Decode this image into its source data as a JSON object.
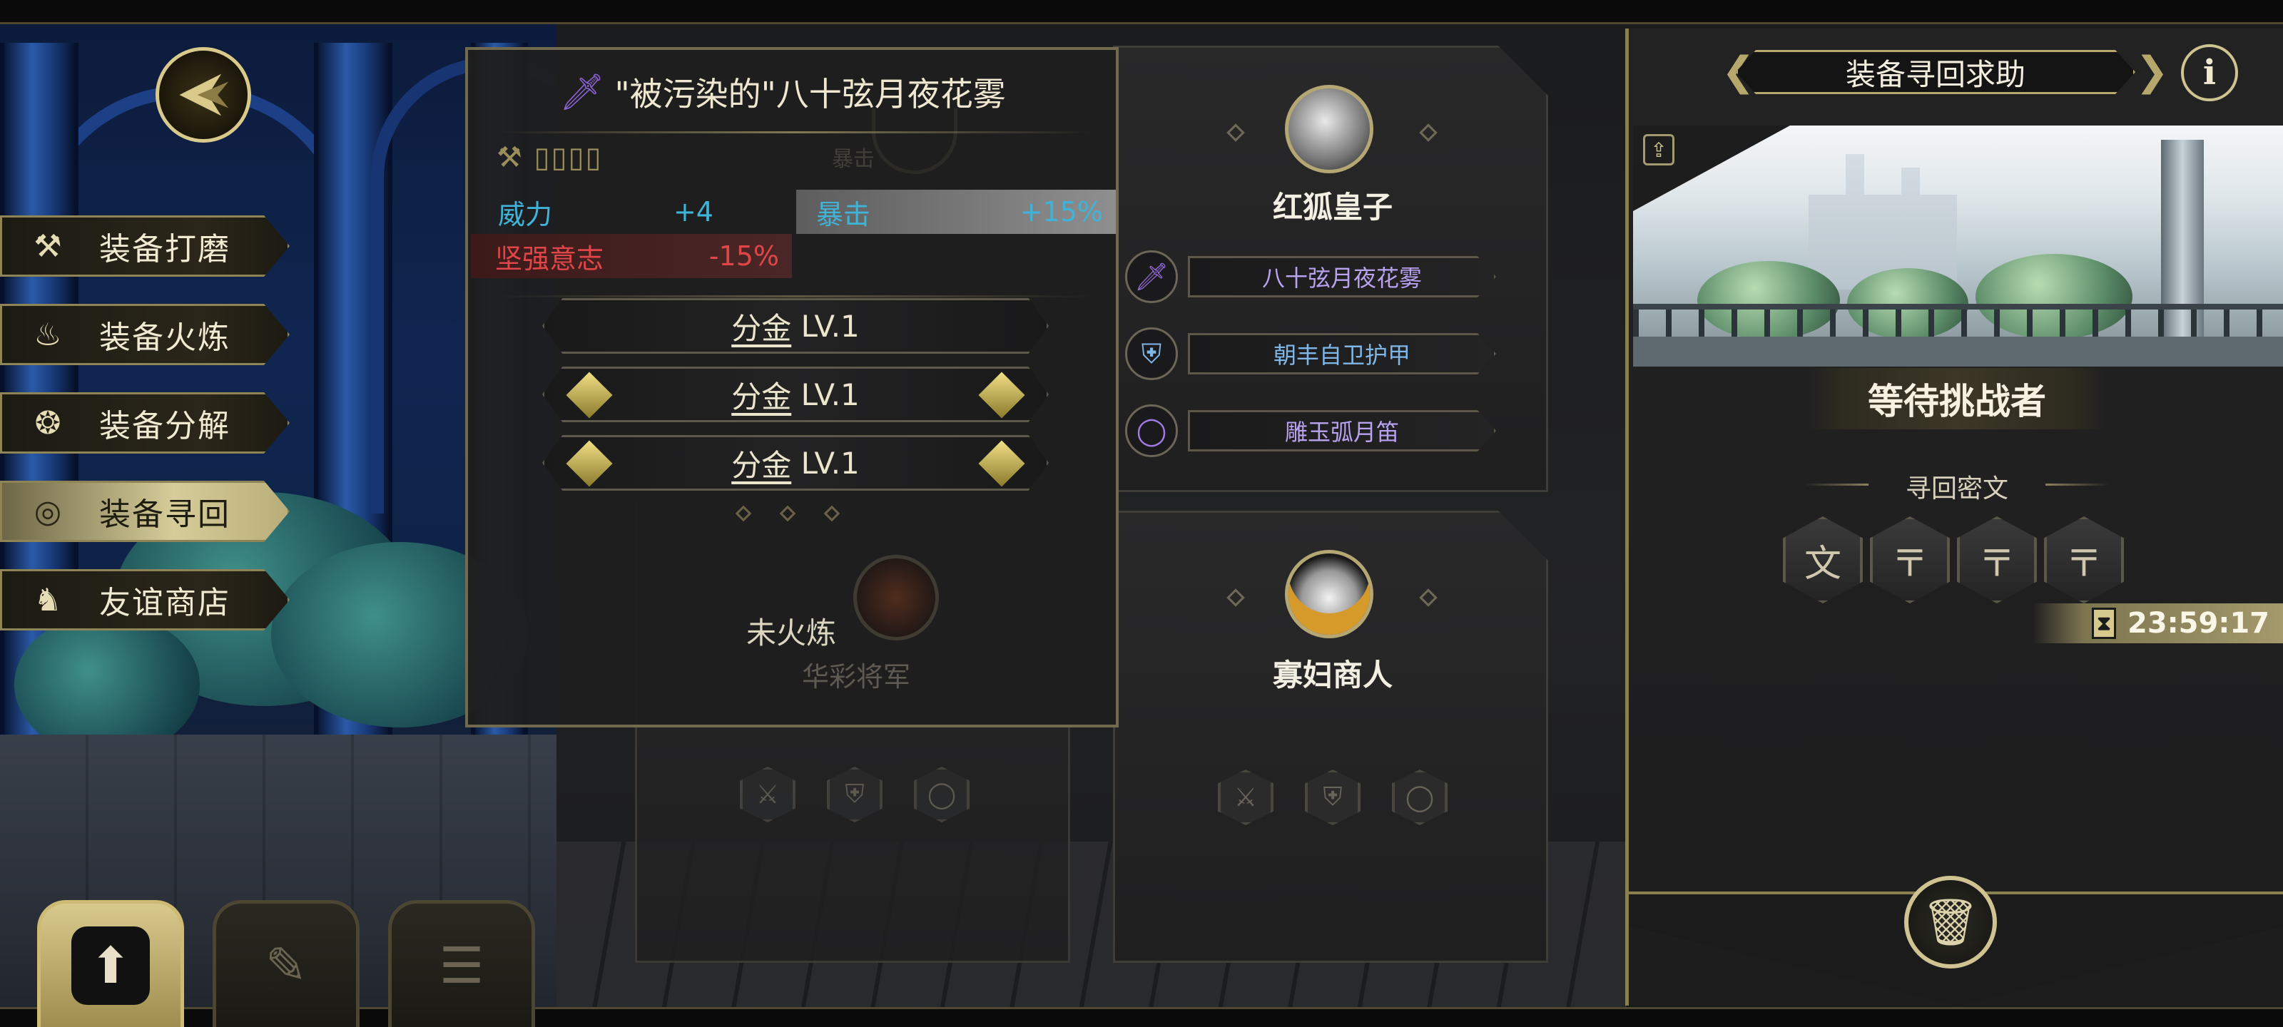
{
  "left_menu": {
    "items": [
      {
        "label": "装备打磨",
        "icon": "hammer-icon",
        "glyph": "⚒",
        "active": false
      },
      {
        "label": "装备火炼",
        "icon": "flame-icon",
        "glyph": "♨",
        "active": false
      },
      {
        "label": "装备分解",
        "icon": "decompose-icon",
        "glyph": "❂",
        "active": false
      },
      {
        "label": "装备寻回",
        "icon": "target-icon",
        "glyph": "◎",
        "active": true
      },
      {
        "label": "友谊商店",
        "icon": "fox-icon",
        "glyph": "♞",
        "active": false
      }
    ],
    "bottom_tabs": [
      {
        "icon": "upload-icon",
        "glyph": "⬆",
        "active": true
      },
      {
        "icon": "feather-icon",
        "glyph": "✎",
        "active": false
      },
      {
        "icon": "list-icon",
        "glyph": "☰",
        "active": false
      }
    ]
  },
  "tooltip": {
    "title": "\"被污染的\"八十弦月夜花雾",
    "icon": "sword-icon",
    "tags": "⚒ ▯▯▯▯",
    "stats": [
      {
        "label": "威力",
        "value": "+4"
      },
      {
        "label": "暴击",
        "value": "+15%"
      },
      {
        "label": "坚强意志",
        "value": "-15%"
      }
    ],
    "enhancements": [
      {
        "name": "分金",
        "level": "LV.1"
      },
      {
        "name": "分金",
        "level": "LV.1"
      },
      {
        "name": "分金",
        "level": "LV.1"
      }
    ],
    "unforged": "未火炼",
    "ghost_name": "华彩将军",
    "ghost_crit": "暴击"
  },
  "cards": [
    {
      "name": "红狐皇子",
      "avatar": "fox-prince-avatar",
      "equipment": [
        {
          "label": "八十弦月夜花雾",
          "icon": "sword-icon",
          "color": "#b9a2f0"
        },
        {
          "label": "朝丰自卫护甲",
          "icon": "armor-icon",
          "color": "#7fb6e8"
        },
        {
          "label": "雕玉弧月笛",
          "icon": "ring-icon",
          "color": "#b9a2f0"
        }
      ]
    },
    {
      "name": "寡妇商人",
      "avatar": "widow-merchant-avatar",
      "equipment": []
    }
  ],
  "right_panel": {
    "title": "装备寻回求助",
    "info": "i",
    "status": "等待挑战者",
    "subtitle": "寻回密文",
    "ciphers": [
      "文",
      "〒",
      "〒",
      "〒"
    ],
    "timer": "23:59:17"
  },
  "colors": {
    "accent_gold": "#cfc391",
    "stat_blue": "#3fb3d8",
    "stat_red": "#e04548",
    "epic_purple": "#8c63d4"
  }
}
